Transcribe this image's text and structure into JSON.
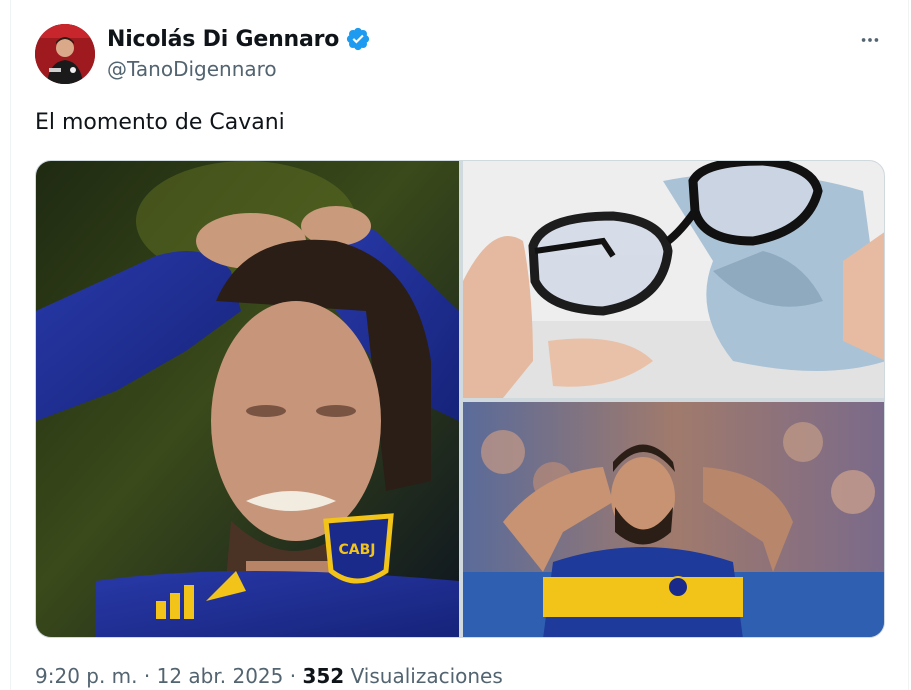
{
  "tweet": {
    "author": {
      "display_name": "Nicolás Di Gennaro",
      "handle": "@TanoDigennaro",
      "verified": true,
      "verified_color": "#1d9bf0"
    },
    "more_icon": "more-horizontal-icon",
    "text": "El momento de Cavani",
    "media": [
      {
        "id": "photo-1",
        "description_icon": "player-hands-on-head-photo"
      },
      {
        "id": "photo-2",
        "description_icon": "glasses-cleaning-photo"
      },
      {
        "id": "photo-3",
        "description_icon": "bearded-player-hands-on-head-photo"
      }
    ],
    "footer": {
      "time": "9:20 p. m.",
      "separator": "·",
      "date": "12 abr. 2025",
      "views_count": "352",
      "views_label": "Visualizaciones"
    }
  },
  "colors": {
    "text_primary": "#0f1419",
    "text_secondary": "#536471",
    "boca_blue": "#1c2f8f",
    "boca_yellow": "#f2c318"
  }
}
